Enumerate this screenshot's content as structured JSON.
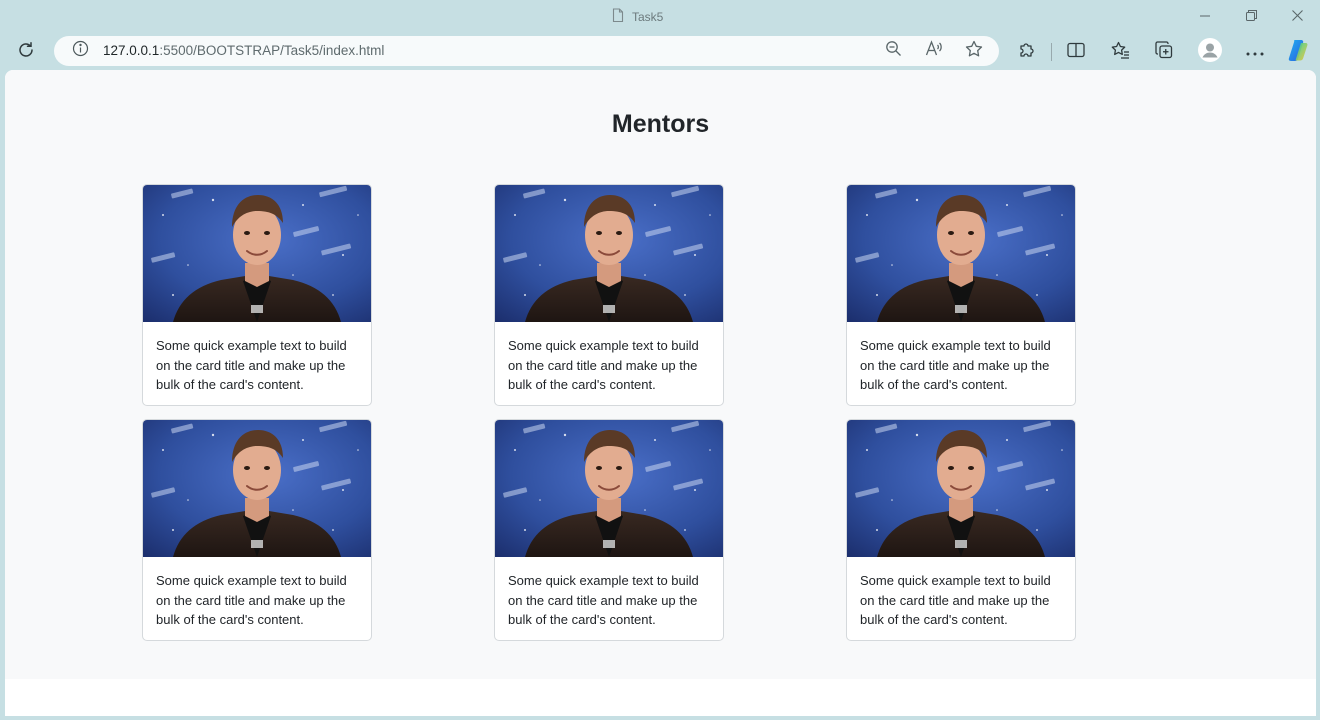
{
  "browser": {
    "tab_title": "Task5",
    "url_host": "127.0.0.1",
    "url_rest": ":5500/BOOTSTRAP/Task5/index.html"
  },
  "icons": {
    "tab": "document-icon",
    "minimize": "minimize-icon",
    "restore": "restore-icon",
    "close": "close-icon",
    "refresh": "refresh-icon",
    "site_info": "info-icon",
    "zoom": "zoom-out-icon",
    "read_aloud": "read-aloud-icon",
    "favorite": "star-icon",
    "extensions": "puzzle-icon",
    "split": "split-screen-icon",
    "favorites": "favorites-icon",
    "collections": "collections-icon",
    "profile": "profile-icon",
    "more": "more-icon",
    "copilot": "copilot-icon"
  },
  "page": {
    "title": "Mentors",
    "cards": [
      {
        "text": "Some quick example text to build on the card title and make up the bulk of the card's content."
      },
      {
        "text": "Some quick example text to build on the card title and make up the bulk of the card's content."
      },
      {
        "text": "Some quick example text to build on the card title and make up the bulk of the card's content."
      },
      {
        "text": "Some quick example text to build on the card title and make up the bulk of the card's content."
      },
      {
        "text": "Some quick example text to build on the card title and make up the bulk of the card's content."
      },
      {
        "text": "Some quick example text to build on the card title and make up the bulk of the card's content."
      }
    ]
  },
  "colors": {
    "chrome": "#c6dfe3",
    "page_bg": "#f8f9fa",
    "card_border": "#d5d9dc",
    "text": "#212529",
    "image_sky": "#2f4f9e"
  }
}
